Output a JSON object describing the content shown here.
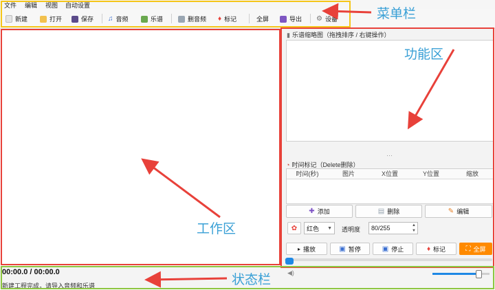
{
  "menu": {
    "items": [
      "文件",
      "编辑",
      "视图",
      "自动设置"
    ]
  },
  "toolbar": {
    "new": "新建",
    "open": "打开",
    "save": "保存",
    "audio": "音频",
    "score": "乐谱",
    "delete_audio": "删音频",
    "mark": "标记",
    "fullscreen": "全屏",
    "export": "导出",
    "settings": "设备"
  },
  "right_panel": {
    "preview_title": "乐谱缩略图（拖拽排序 / 右键操作）",
    "dots": "⋯",
    "markers_title": "时间标记（Delete删除）",
    "columns": [
      "时间(秒)",
      "图片",
      "X位置",
      "Y位置",
      "缩放"
    ],
    "add": "添加",
    "delete": "删除",
    "edit": "编辑",
    "color": "红色",
    "opacity_label": "透明度",
    "opacity_value": "80/255",
    "play": "播放",
    "pause": "暂停",
    "stop": "停止",
    "mark": "标记",
    "fullscreen": "全屏"
  },
  "status": {
    "time": "00:00.0 / 00:00.0",
    "message": "新建工程完成，请导入音频和乐谱"
  },
  "annotations": {
    "menubar": "菜单栏",
    "function_area": "功能区",
    "work_area": "工作区",
    "status_bar": "状态栏"
  },
  "colors": {
    "menubar_box": "#f5c518",
    "function_box": "#e8413a",
    "work_box": "#e8413a",
    "status_box": "#8dc63f",
    "accent_orange": "#ff8a00",
    "slider_blue": "#1e88e5",
    "annotation_text": "#3aa0d6"
  }
}
